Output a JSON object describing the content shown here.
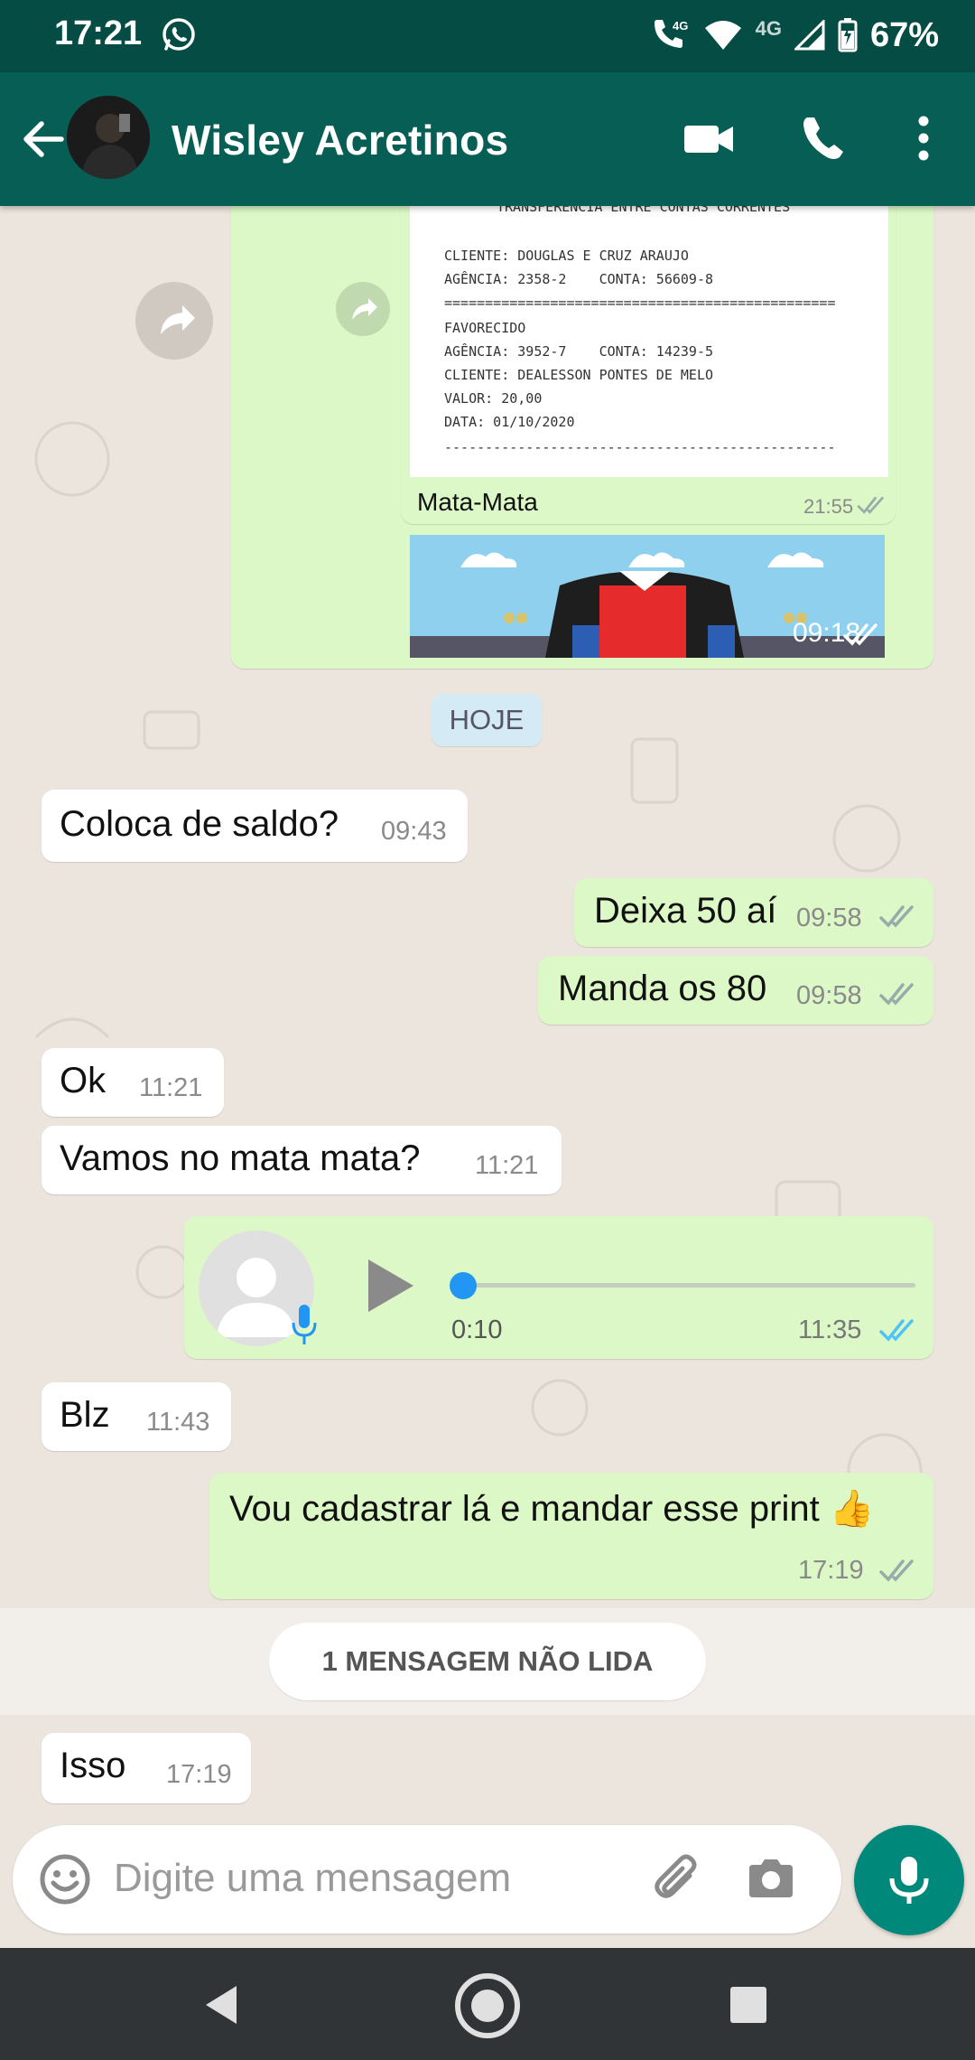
{
  "status_bar": {
    "time": "17:21",
    "network_4g_left": "4G",
    "network_4g_right": "4G",
    "battery": "67%"
  },
  "app_bar": {
    "contact_name": "Wisley Acretinos"
  },
  "forwarded_receipt": {
    "lines": [
      "TRANSFERENCIA ENTRE CONTAS CORRENTES",
      "CLIENTE: DOUGLAS E CRUZ ARAUJO",
      "AGÊNCIA: 2358-2    CONTA: 56609-8",
      "================================================",
      "FAVORECIDO",
      "AGÊNCIA: 3952-7    CONTA: 14239-5",
      "CLIENTE: DEALESSON PONTES DE MELO",
      "VALOR: 20,00",
      "DATA: 01/10/2020",
      "------------------------------------------------"
    ],
    "caption": "Mata-Mata",
    "caption_time": "21:55",
    "image_time": "09:18"
  },
  "date_chip": "HOJE",
  "messages": [
    {
      "dir": "in",
      "text": "Coloca de saldo?",
      "time": "09:43"
    },
    {
      "dir": "out",
      "text": "Deixa 50 aí",
      "time": "09:58"
    },
    {
      "dir": "out",
      "text": "Manda os 80",
      "time": "09:58"
    },
    {
      "dir": "in",
      "text": "Ok",
      "time": "11:21"
    },
    {
      "dir": "in",
      "text": "Vamos no mata mata?",
      "time": "11:21"
    },
    {
      "dir": "out",
      "type": "voice",
      "duration": "0:10",
      "time": "11:35",
      "progress": 0
    },
    {
      "dir": "in",
      "text": "Blz",
      "time": "11:43"
    },
    {
      "dir": "out",
      "text": "Vou cadastrar lá e mandar esse print 👍",
      "time": "17:19"
    },
    {
      "dir": "in",
      "text": "Isso",
      "time": "17:19"
    }
  ],
  "unread_banner": "1 MENSAGEM NÃO LIDA",
  "composer": {
    "placeholder": "Digite uma mensagem"
  },
  "colors": {
    "header": "#075e54",
    "status_bar": "#054d44",
    "bubble_out": "#dcf8c6",
    "bubble_in": "#ffffff",
    "chat_bg": "#ece5dd",
    "fab": "#00897b",
    "read_tick": "#4fc3f7"
  }
}
